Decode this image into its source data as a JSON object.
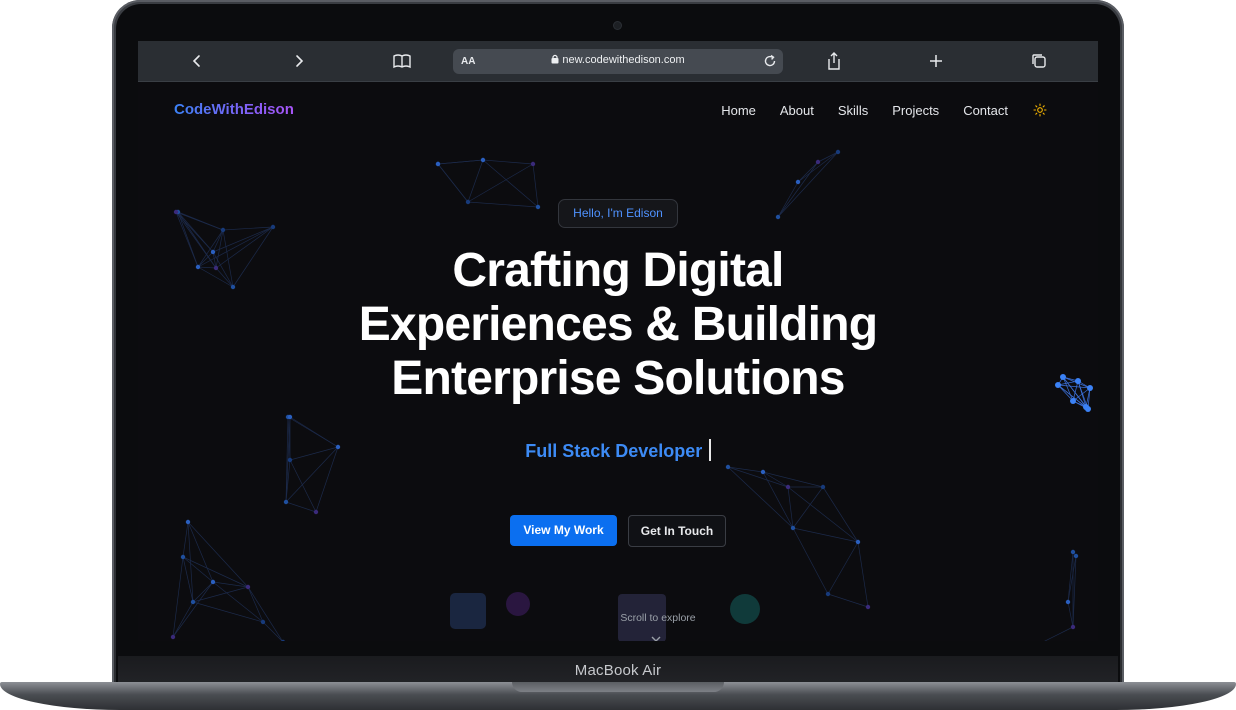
{
  "device": {
    "label": "MacBook Air"
  },
  "browser": {
    "url": "new.codewithedison.com",
    "text_size_label": "AA",
    "icons": [
      "back-icon",
      "forward-icon",
      "bookmarks-icon",
      "lock-icon",
      "reload-icon",
      "share-icon",
      "new-tab-icon",
      "tabs-icon"
    ]
  },
  "site": {
    "logo": "CodeWithEdison",
    "nav": [
      "Home",
      "About",
      "Skills",
      "Projects",
      "Contact"
    ],
    "theme_toggle_icon": "sun-icon",
    "greeting": "Hello, I'm Edison",
    "headline_lines": [
      "Crafting Digital",
      "Experiences & Building",
      "Enterprise Solutions"
    ],
    "role": "Full Stack Developer",
    "cta_primary": "View My Work",
    "cta_secondary": "Get In Touch",
    "scroll_hint": "Scroll to explore"
  },
  "colors": {
    "accent": "#0b6ff0",
    "role_text": "#3d8bf5",
    "logo_gradient": [
      "#3b82f6",
      "#a855f7"
    ],
    "page_bg": "#0c0c0f",
    "sun": "#f5b400"
  }
}
